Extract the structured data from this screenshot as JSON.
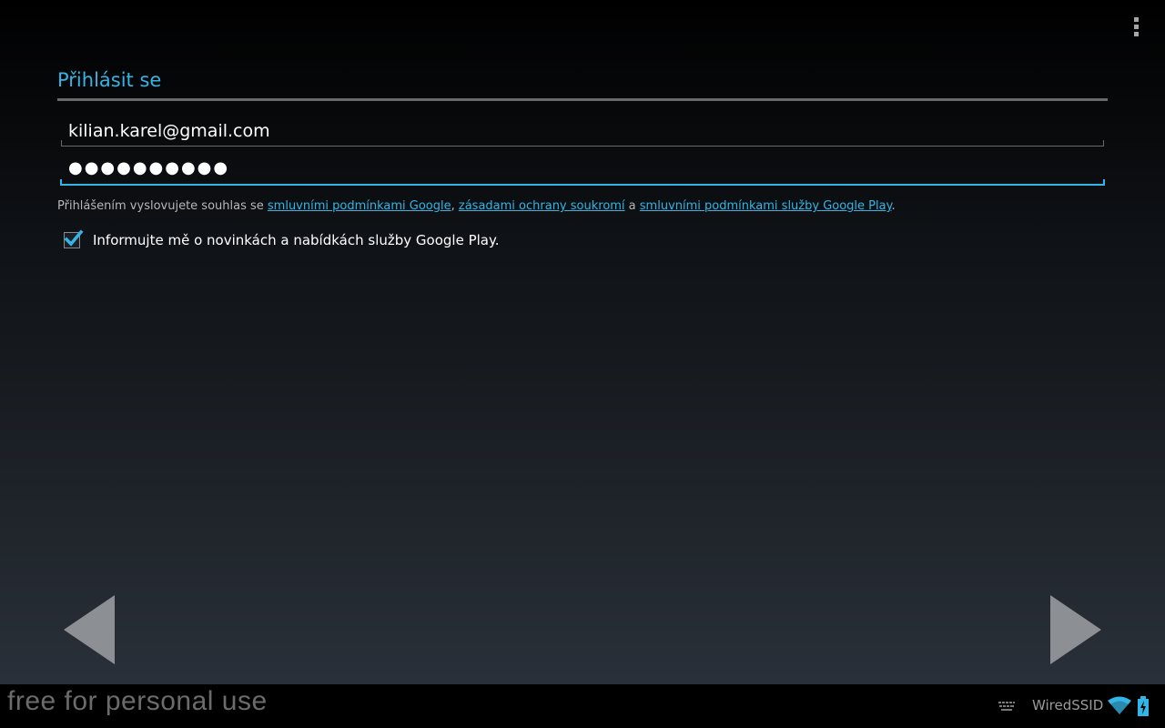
{
  "header": {
    "title": "Přihlásit se",
    "menu_icon": "overflow-menu-icon"
  },
  "form": {
    "email_value": "kilian.karel@gmail.com",
    "password_value": "●●●●●●●●●●"
  },
  "terms": {
    "prefix": "Přihlášením vyslovujete souhlas se ",
    "link1": "smluvními podmínkami Google",
    "sep1": ", ",
    "link2": "zásadami ochrany soukromí",
    "sep2": " a ",
    "link3": "smluvními podmínkami služby Google Play",
    "suffix": "."
  },
  "newsletter": {
    "checked": true,
    "label": "Informujte mě o novinkách a nabídkách služby Google Play."
  },
  "navigation": {
    "prev_icon": "back-arrow-icon",
    "next_icon": "next-arrow-icon"
  },
  "system_bar": {
    "watermark": "free for personal use",
    "ssid": "WiredSSID",
    "icons": [
      "keyboard-icon",
      "wifi-icon",
      "battery-charging-icon"
    ]
  },
  "colors": {
    "accent": "#33b5e5",
    "text": "#ffffff",
    "secondary_text": "#b7b7b7",
    "arrow": "#8c8f94"
  }
}
